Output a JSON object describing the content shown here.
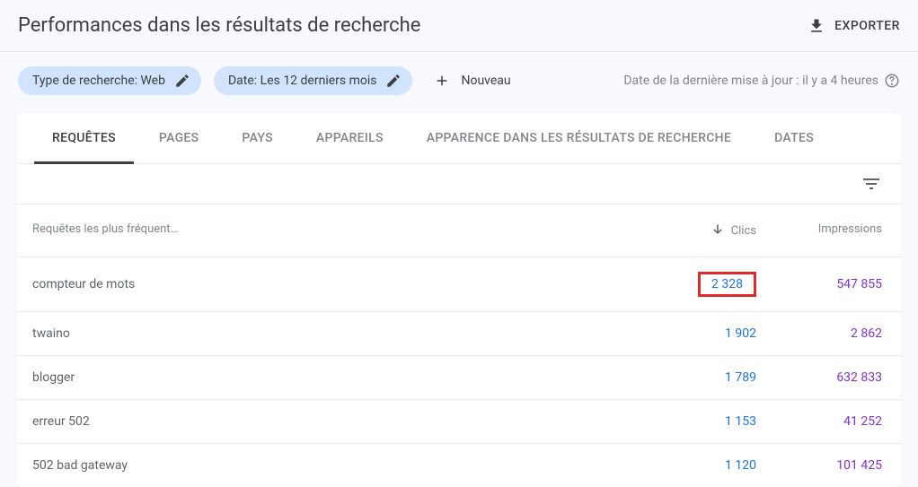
{
  "header": {
    "title": "Performances dans les résultats de recherche",
    "export_label": "EXPORTER"
  },
  "filters": {
    "search_type": "Type de recherche: Web",
    "date": "Date: Les 12 derniers mois",
    "add_new": "Nouveau",
    "last_update": "Date de la dernière mise à jour : il y a 4 heures"
  },
  "tabs": {
    "requetes": "REQUÊTES",
    "pages": "PAGES",
    "pays": "PAYS",
    "appareils": "APPAREILS",
    "apparence": "APPARENCE DANS LES RÉSULTATS DE RECHERCHE",
    "dates": "DATES"
  },
  "table": {
    "header_query": "Requêtes les plus fréquent…",
    "header_clicks": "Clics",
    "header_impressions": "Impressions",
    "rows": [
      {
        "query": "compteur de mots",
        "clicks": "2 328",
        "impressions": "547 855",
        "highlight": true
      },
      {
        "query": "twaino",
        "clicks": "1 902",
        "impressions": "2 862",
        "highlight": false
      },
      {
        "query": "blogger",
        "clicks": "1 789",
        "impressions": "632 833",
        "highlight": false
      },
      {
        "query": "erreur 502",
        "clicks": "1 153",
        "impressions": "41 252",
        "highlight": false
      },
      {
        "query": "502 bad gateway",
        "clicks": "1 120",
        "impressions": "101 425",
        "highlight": false
      }
    ]
  }
}
